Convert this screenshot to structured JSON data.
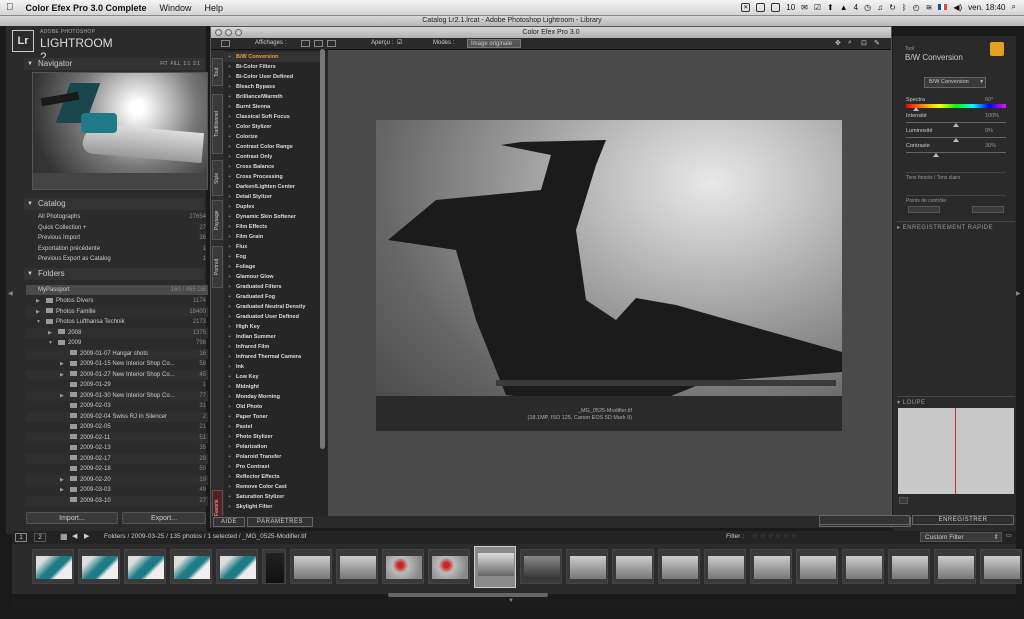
{
  "menubar": {
    "app": "Color Efex Pro 3.0 Complete",
    "menus": [
      "Window",
      "Help"
    ],
    "battery": "10",
    "clock": "ven. 18:40",
    "num": "4"
  },
  "lr_window_title": "Catalog Lr2.1.lrcat - Adobe Photoshop Lightroom - Library",
  "lr_logo": {
    "mark": "Lr",
    "line1": "ADOBE PHOTOSHOP",
    "line2": "LIGHTROOM 2"
  },
  "navigator": {
    "title": "Navigator",
    "zoom": [
      "FIT",
      "FILL",
      "1:1",
      "2:1"
    ]
  },
  "catalog": {
    "title": "Catalog",
    "items": [
      {
        "label": "All Photographs",
        "count": "27654"
      },
      {
        "label": "Quick Collection +",
        "count": "27"
      },
      {
        "label": "Previous Import",
        "count": "36"
      },
      {
        "label": "Exportation précédente",
        "count": "1"
      },
      {
        "label": "Previous Export as Catalog",
        "count": "1"
      }
    ]
  },
  "folders": {
    "title": "Folders",
    "drive": "MyPassport",
    "drive_info": "160 / 465 GB",
    "items": [
      {
        "label": "Photos Divers",
        "count": "1174",
        "indent": 1,
        "arrow": "▶"
      },
      {
        "label": "Photos Famille",
        "count": "18400",
        "indent": 1,
        "arrow": "▶"
      },
      {
        "label": "Photos Lufthansa Technik",
        "count": "2173",
        "indent": 1,
        "arrow": "▼"
      },
      {
        "label": "2008",
        "count": "1375",
        "indent": 2,
        "arrow": "▶"
      },
      {
        "label": "2009",
        "count": "798",
        "indent": 2,
        "arrow": "▼"
      },
      {
        "label": "2009-01-07 Hangar shots",
        "count": "16",
        "indent": 3,
        "arrow": ""
      },
      {
        "label": "2009-01-15 New Interior Shop Co...",
        "count": "59",
        "indent": 3,
        "arrow": "▶"
      },
      {
        "label": "2009-01-27 New Interior Shop Co...",
        "count": "45",
        "indent": 3,
        "arrow": "▶"
      },
      {
        "label": "2009-01-29",
        "count": "1",
        "indent": 3,
        "arrow": ""
      },
      {
        "label": "2009-01-30 New Interior Shop Co...",
        "count": "77",
        "indent": 3,
        "arrow": "▶"
      },
      {
        "label": "2009-02-03",
        "count": "31",
        "indent": 3,
        "arrow": ""
      },
      {
        "label": "2009-02-04 Swiss RJ In Silencer",
        "count": "2",
        "indent": 3,
        "arrow": ""
      },
      {
        "label": "2009-02-05",
        "count": "21",
        "indent": 3,
        "arrow": ""
      },
      {
        "label": "2009-02-11",
        "count": "51",
        "indent": 3,
        "arrow": ""
      },
      {
        "label": "2009-02-13",
        "count": "35",
        "indent": 3,
        "arrow": ""
      },
      {
        "label": "2009-02-17",
        "count": "29",
        "indent": 3,
        "arrow": ""
      },
      {
        "label": "2009-02-18",
        "count": "50",
        "indent": 3,
        "arrow": ""
      },
      {
        "label": "2009-02-20",
        "count": "19",
        "indent": 3,
        "arrow": "▶"
      },
      {
        "label": "2009-03-03",
        "count": "49",
        "indent": 3,
        "arrow": "▶"
      },
      {
        "label": "2009-03-10",
        "count": "27",
        "indent": 3,
        "arrow": ""
      }
    ]
  },
  "left_buttons": {
    "import": "Import...",
    "export": "Export..."
  },
  "cef": {
    "title": "Color Efex Pro 3.0",
    "toolbar": {
      "affichages": "Affichages :",
      "apercu": "Aperçu :",
      "modes": "Modes :",
      "mode_value": "Image originale"
    },
    "vtabs": [
      "Tout",
      "Traditionnel",
      "Style",
      "Paysage",
      "Portrait",
      "Favoris"
    ],
    "filters": [
      "B/W Conversion",
      "Bi-Color Filters",
      "Bi-Color User Defined",
      "Bleach Bypass",
      "Brilliance/Warmth",
      "Burnt Sienna",
      "Classical Soft Focus",
      "Color Stylizer",
      "Colorize",
      "Contrast Color Range",
      "Contrast Only",
      "Cross Balance",
      "Cross Processing",
      "Darken/Lighten Center",
      "Detail Stylizer",
      "Duplex",
      "Dynamic Skin Softener",
      "Film Effects",
      "Film Grain",
      "Flux",
      "Fog",
      "Foliage",
      "Glamour Glow",
      "Graduated Filters",
      "Graduated Fog",
      "Graduated Neutral Density",
      "Graduated User Defined",
      "High Key",
      "Indian Summer",
      "Infrared Film",
      "Infrared Thermal Camera",
      "Ink",
      "Low Key",
      "Midnight",
      "Monday Morning",
      "Old Photo",
      "Paper Toner",
      "Pastel",
      "Photo Stylizer",
      "Polarization",
      "Polaroid Transfer",
      "Pro Contrast",
      "Reflector Effects",
      "Remove Color Cast",
      "Saturation Stylizer",
      "Skylight Filter"
    ],
    "caption_line1": "_MG_0525-Modifier.tif",
    "caption_line2": "(18.1MP, ISO 125, Canon EOS 5D Mark II)",
    "buttons": {
      "aide": "AIDE",
      "parametres": "PARAMETRES",
      "annuler": "ANNULER",
      "enregistrer": "ENREGISTRER"
    },
    "right": {
      "tool_label": "Tool",
      "filter_name": "B/W Conversion",
      "dropdown": "B/W Conversion",
      "sliders": [
        {
          "label": "Spectra",
          "value": "60°",
          "pos": 0.1
        },
        {
          "label": "Intensité",
          "value": "100%",
          "pos": 0.5
        },
        {
          "label": "Luminosité",
          "value": "0%",
          "pos": 0.5
        },
        {
          "label": "Contraste",
          "value": "30%",
          "pos": 0.3
        }
      ],
      "tons": "Tons foncés / Tons clairs",
      "points": "Points de contrôle",
      "enreg": "ENREGISTREMENT RAPIDE",
      "loupe": "LOUPE"
    }
  },
  "strip": {
    "pages": [
      "1",
      "2"
    ],
    "path": "Folders / 2009-03-25 / 135 photos / 1 selected / _MG_0525-Modifier.tif",
    "filter_label": "Filter :",
    "filter_value": "Custom Filter"
  },
  "colors": {
    "accent": "#f0a030",
    "teal": "#1d7a86"
  }
}
